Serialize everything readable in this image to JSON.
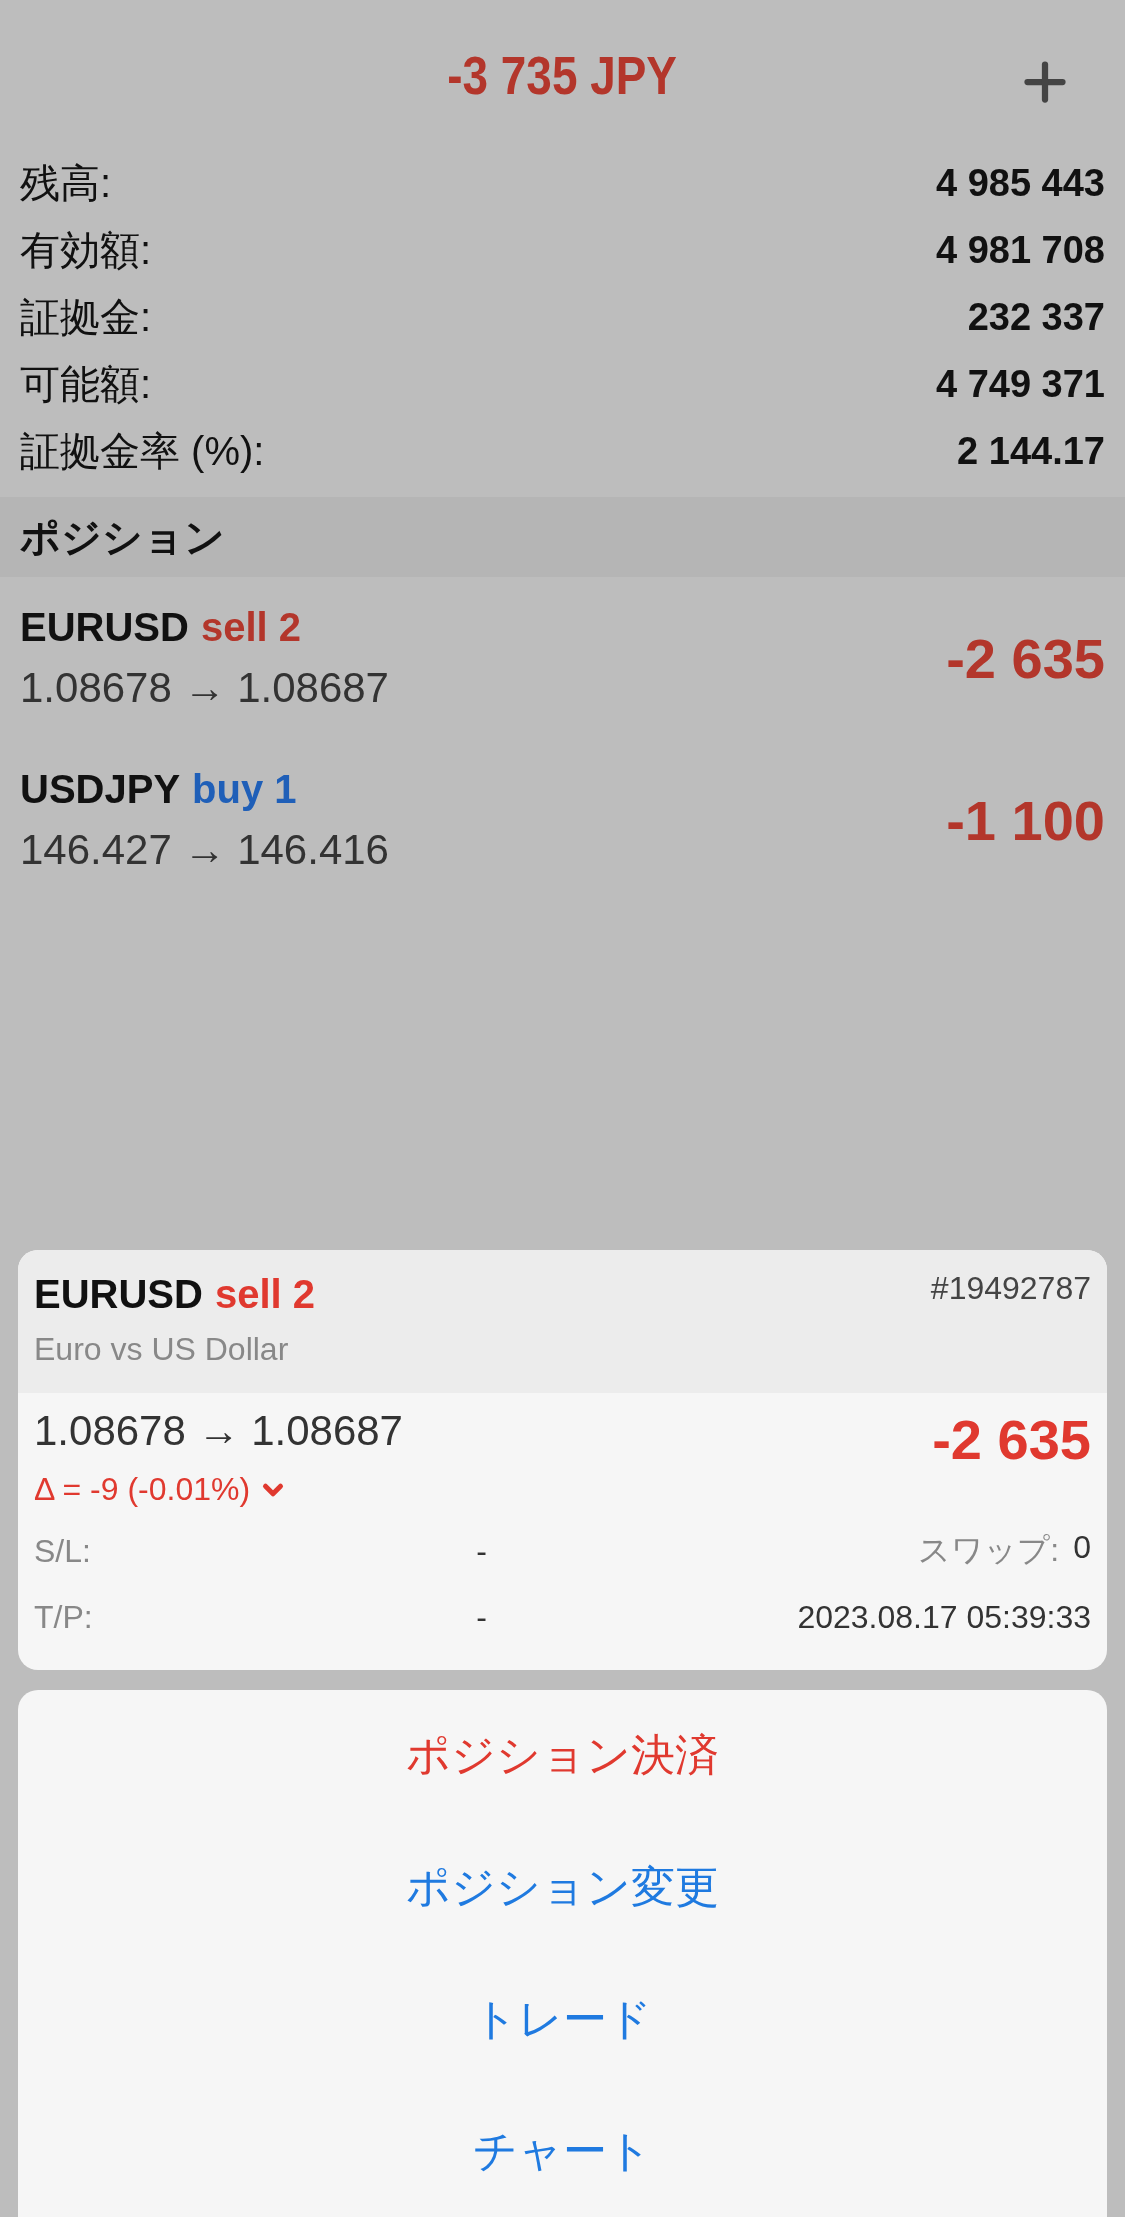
{
  "header": {
    "total": "-3 735 JPY"
  },
  "account": [
    {
      "label": "残高:",
      "value": "4 985 443"
    },
    {
      "label": "有効額:",
      "value": "4 981 708"
    },
    {
      "label": "証拠金:",
      "value": "232 337"
    },
    {
      "label": "可能額:",
      "value": "4 749 371"
    },
    {
      "label": "証拠金率 (%):",
      "value": "2 144.17"
    }
  ],
  "positions": {
    "title": "ポジション",
    "items": [
      {
        "symbol": "EURUSD",
        "side": "sell 2",
        "kind": "sell",
        "prices": "1.08678 → 1.08687",
        "profit": "-2 635"
      },
      {
        "symbol": "USDJPY",
        "side": "buy 1",
        "kind": "buy",
        "prices": "146.427 → 146.416",
        "profit": "-1 100"
      }
    ]
  },
  "detail": {
    "symbol": "EURUSD",
    "side": "sell 2",
    "kind": "sell",
    "ticket": "#19492787",
    "description": "Euro vs US Dollar",
    "prices": "1.08678 → 1.08687",
    "delta": "Δ = -9 (-0.01%)",
    "profit": "-2 635",
    "fields": [
      {
        "label": "S/L:",
        "value": "-",
        "extra_label": "スワップ:",
        "extra_value": "0"
      },
      {
        "label": "T/P:",
        "value": "-",
        "extra_value": "2023.08.17 05:39:33"
      }
    ]
  },
  "actions": [
    {
      "label": "ポジション決済",
      "kind": "destructive"
    },
    {
      "label": "ポジション変更",
      "kind": "default"
    },
    {
      "label": "トレード",
      "kind": "default"
    },
    {
      "label": "チャート",
      "kind": "default"
    }
  ]
}
